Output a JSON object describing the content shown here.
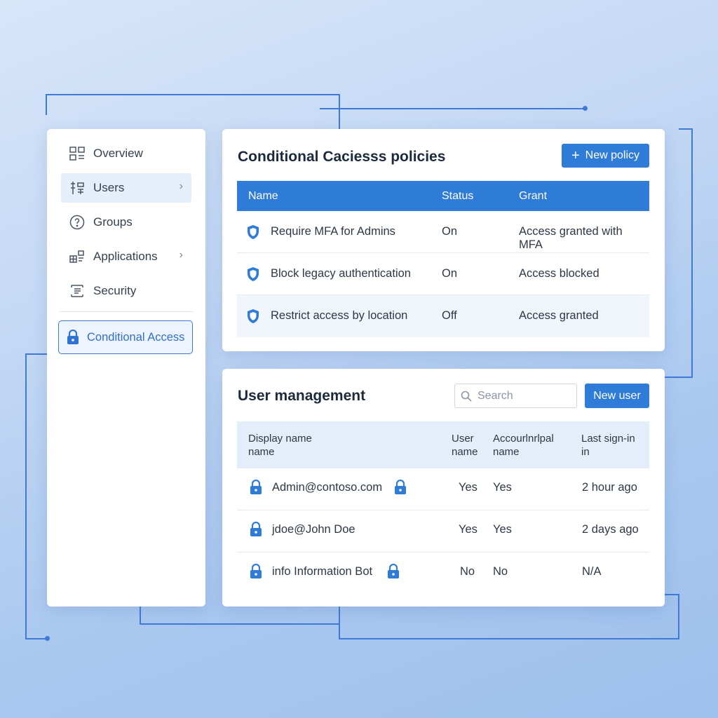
{
  "colors": {
    "accent": "#2f7bd8",
    "sidebar_bg": "#ffffff",
    "active_bg": "#e5eefb",
    "table_header": "#2f7bd8",
    "user_header": "#e4eefb"
  },
  "sidebar": {
    "items": [
      {
        "label": "Overview",
        "icon": "overview-icon",
        "chevron": false
      },
      {
        "label": "Users",
        "icon": "users-icon",
        "chevron": true,
        "active": true
      },
      {
        "label": "Groups",
        "icon": "groups-icon",
        "chevron": false
      },
      {
        "label": "Applications",
        "icon": "applications-icon",
        "chevron": true
      },
      {
        "label": "Security",
        "icon": "security-icon",
        "chevron": false
      }
    ],
    "selected": {
      "label": "Conditional Access",
      "icon": "lock-icon"
    }
  },
  "policies": {
    "title": "Conditional Caciesss policies",
    "new_button": "New policy",
    "new_button_icon": "plus-icon",
    "columns": [
      "Name",
      "Status",
      "Grant"
    ],
    "rows": [
      {
        "name": "Require MFA for Admins",
        "status": "On",
        "grant": "Access granted with MFA"
      },
      {
        "name": "Block legacy authentication",
        "status": "On",
        "grant": "Access blocked"
      },
      {
        "name": "Restrict access by location",
        "status": "Off",
        "grant": "Access granted"
      }
    ]
  },
  "users": {
    "title": "User management",
    "search_placeholder": "Search",
    "new_button": "New user",
    "columns": [
      {
        "line1": "Display name",
        "line2": "name"
      },
      {
        "line1": "User",
        "line2": "name"
      },
      {
        "line1": "Accourlnrlpal",
        "line2": "name"
      },
      {
        "line1": "Last sign-in",
        "line2": "in"
      }
    ],
    "rows": [
      {
        "display": "Admin@contoso.com",
        "trailing_lock": true,
        "user": "Yes",
        "principal": "Yes",
        "last": "2 hour ago"
      },
      {
        "display": "jdoe@John Doe",
        "trailing_lock": false,
        "user": "Yes",
        "principal": "Yes",
        "last": "2 days ago"
      },
      {
        "display": "info Information Bot",
        "trailing_lock": true,
        "user": "No",
        "principal": "No",
        "last": "N/A"
      }
    ]
  }
}
